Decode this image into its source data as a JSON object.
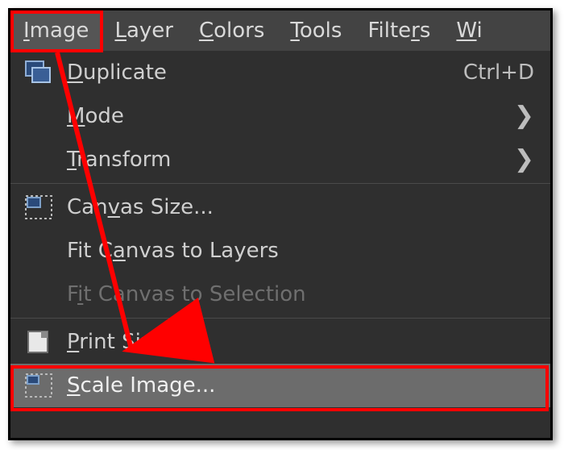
{
  "menubar": {
    "image": {
      "pre": "",
      "mn": "I",
      "post": "mage"
    },
    "layer": {
      "pre": "",
      "mn": "L",
      "post": "ayer"
    },
    "colors": {
      "pre": "",
      "mn": "C",
      "post": "olors"
    },
    "tools": {
      "pre": "",
      "mn": "T",
      "post": "ools"
    },
    "filters": {
      "pre": "Filte",
      "mn": "r",
      "post": "s"
    },
    "windows": {
      "pre": "",
      "mn": "W",
      "post": "i"
    }
  },
  "items": {
    "duplicate": {
      "pre": "",
      "mn": "D",
      "post": "uplicate",
      "accel": "Ctrl+D"
    },
    "mode": {
      "pre": "",
      "mn": "M",
      "post": "ode"
    },
    "transform": {
      "pre": "",
      "mn": "T",
      "post": "ransform"
    },
    "canvas": {
      "pre": "Can",
      "mn": "v",
      "post": "as Size..."
    },
    "fitlayers": {
      "pre": "Fit C",
      "mn": "a",
      "post": "nvas to Layers"
    },
    "fitsel": {
      "pre": "F",
      "mn": "i",
      "post": "t Canvas to Selection"
    },
    "print": {
      "pre": "",
      "mn": "P",
      "post": "rint Size..."
    },
    "scale": {
      "pre": "",
      "mn": "S",
      "post": "cale Image..."
    }
  },
  "arrow_submenu": "❯"
}
